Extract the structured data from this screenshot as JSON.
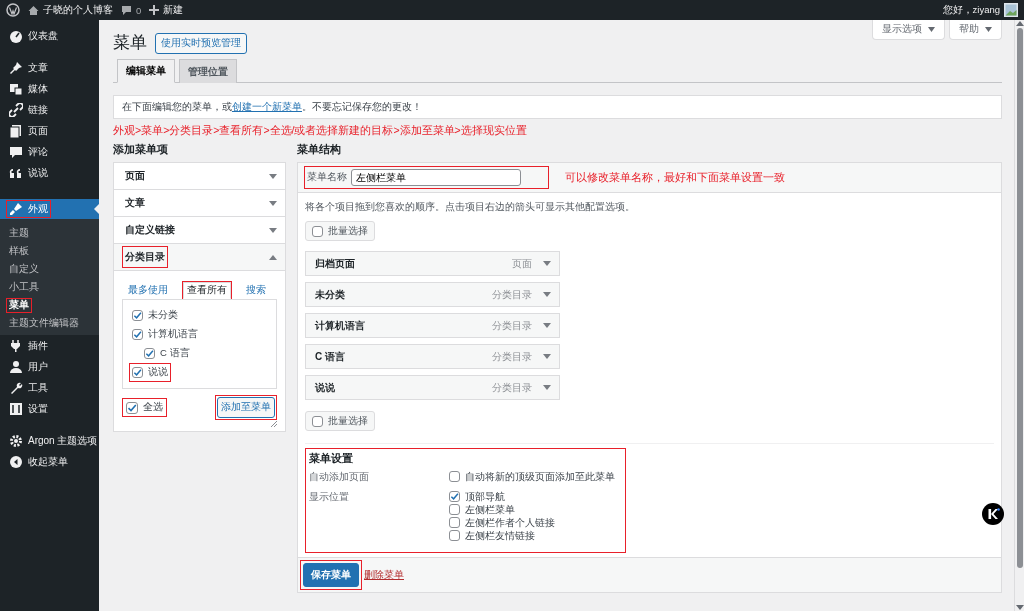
{
  "admin_bar": {
    "site_name": "子晓的个人博客",
    "comment_count": "0",
    "new_label": "新建",
    "greeting": "您好，ziyang"
  },
  "sidebar": {
    "groups": [
      [
        {
          "label": "仪表盘",
          "current": false,
          "highlighted": false
        }
      ],
      [
        {
          "label": "文章",
          "current": false,
          "highlighted": false
        },
        {
          "label": "媒体",
          "current": false,
          "highlighted": false
        },
        {
          "label": "链接",
          "current": false,
          "highlighted": false
        },
        {
          "label": "页面",
          "current": false,
          "highlighted": false
        },
        {
          "label": "评论",
          "current": false,
          "highlighted": false
        },
        {
          "label": "说说",
          "current": false,
          "highlighted": false
        }
      ],
      [
        {
          "label": "外观",
          "current": true,
          "highlighted": true,
          "children": [
            {
              "label": "主题",
              "current": false,
              "highlighted": false
            },
            {
              "label": "样板",
              "current": false,
              "highlighted": false
            },
            {
              "label": "自定义",
              "current": false,
              "highlighted": false
            },
            {
              "label": "小工具",
              "current": false,
              "highlighted": false
            },
            {
              "label": "菜单",
              "current": true,
              "highlighted": true
            },
            {
              "label": "主题文件编辑器",
              "current": false,
              "highlighted": false
            }
          ]
        },
        {
          "label": "插件",
          "current": false,
          "highlighted": false
        },
        {
          "label": "用户",
          "current": false,
          "highlighted": false
        },
        {
          "label": "工具",
          "current": false,
          "highlighted": false
        },
        {
          "label": "设置",
          "current": false,
          "highlighted": false
        }
      ],
      [
        {
          "label": "Argon 主题选项",
          "current": false,
          "highlighted": false
        },
        {
          "label": "收起菜单",
          "current": false,
          "highlighted": false
        }
      ]
    ]
  },
  "screen_meta": [
    {
      "label": "显示选项"
    },
    {
      "label": "帮助"
    }
  ],
  "page": {
    "title": "菜单",
    "live_preview_button": "使用实时预览管理",
    "tabs": [
      {
        "label": "编辑菜单",
        "selected": true
      },
      {
        "label": "管理位置",
        "selected": false
      }
    ],
    "notice": {
      "before": "在下面编辑您的菜单，或",
      "link": "创建一个新菜单",
      "after": "。不要忘记保存您的更改！"
    },
    "annotation": "外观>菜单>分类目录>查看所有>全选/或者选择新建的目标>添加至菜单>选择现实位置",
    "add_items": {
      "heading": "添加菜单项",
      "sections": [
        {
          "label": "页面",
          "expanded": false,
          "highlighted": false
        },
        {
          "label": "文章",
          "expanded": false,
          "highlighted": false
        },
        {
          "label": "自定义链接",
          "expanded": false,
          "highlighted": false
        },
        {
          "label": "分类目录",
          "expanded": true,
          "highlighted": true
        }
      ],
      "tabs": [
        {
          "label": "最多使用",
          "selected": false,
          "highlighted": false
        },
        {
          "label": "查看所有",
          "selected": true,
          "highlighted": true
        },
        {
          "label": "搜索",
          "selected": false,
          "highlighted": false
        }
      ],
      "categories": [
        {
          "label": "未分类",
          "checked": true,
          "highlighted": false
        },
        {
          "label": "计算机语言",
          "checked": true,
          "highlighted": false,
          "children": [
            {
              "label": "C 语言",
              "checked": true,
              "highlighted": false
            }
          ]
        },
        {
          "label": "说说",
          "checked": true,
          "highlighted": true
        }
      ],
      "select_all": {
        "label": "全选",
        "checked": true,
        "highlighted": true
      },
      "add_button": {
        "label": "添加至菜单",
        "highlighted": true
      }
    },
    "structure": {
      "heading": "菜单结构",
      "name_label": "菜单名称",
      "name_value": "左侧栏菜单",
      "name_highlighted": true,
      "name_annotation": "可以修改菜单名称，最好和下面菜单设置一致",
      "instructions": "将各个项目拖到您喜欢的顺序。点击项目右边的箭头可显示其他配置选项。",
      "bulk_select_top": {
        "label": "批量选择",
        "checked": false
      },
      "items": [
        {
          "title": "归档页面",
          "type": "页面"
        },
        {
          "title": "未分类",
          "type": "分类目录"
        },
        {
          "title": "计算机语言",
          "type": "分类目录"
        },
        {
          "title": "C 语言",
          "type": "分类目录"
        },
        {
          "title": "说说",
          "type": "分类目录"
        }
      ],
      "bulk_select_bottom": {
        "label": "批量选择",
        "checked": false
      },
      "settings": {
        "heading": "菜单设置",
        "highlighted": true,
        "rows": [
          {
            "label": "自动添加页面",
            "options": [
              {
                "label": "自动将新的顶级页面添加至此菜单",
                "checked": false
              }
            ]
          },
          {
            "label": "显示位置",
            "options": [
              {
                "label": "顶部导航",
                "checked": true
              },
              {
                "label": "左侧栏菜单",
                "checked": false
              },
              {
                "label": "左侧栏作者个人链接",
                "checked": false
              },
              {
                "label": "左侧栏友情链接",
                "checked": false
              }
            ]
          }
        ]
      },
      "save_button": {
        "label": "保存菜单",
        "highlighted": true
      },
      "delete_link": "删除菜单"
    }
  }
}
